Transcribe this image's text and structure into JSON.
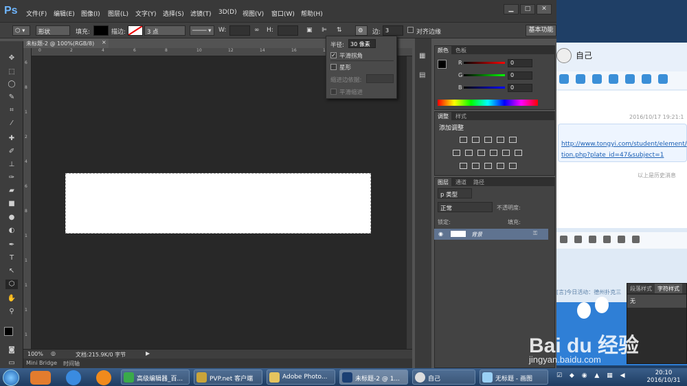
{
  "menu": {
    "items": [
      "文件(F)",
      "编辑(E)",
      "图像(I)",
      "图层(L)",
      "文字(Y)",
      "选择(S)",
      "滤镜(T)",
      "3D(D)",
      "视图(V)",
      "窗口(W)",
      "帮助(H)"
    ],
    "logo": "Ps",
    "min": "▁",
    "max": "□",
    "close": "✕"
  },
  "options": {
    "mode": "形状",
    "fill_label": "填充:",
    "stroke_label": "描边:",
    "stroke_size": "3 点",
    "w_label": "W:",
    "h_label": "H:",
    "sides_label": "边:",
    "sides_value": "3",
    "align_edges": "对齐边缘",
    "workspace": "基本功能"
  },
  "doc": {
    "tab": "未标题-2 @ 100%(RGB/8)",
    "close": "×",
    "zoom": "100%",
    "info": "文档:215.9K/0 字节",
    "ruler_top": [
      "0",
      "2",
      "4",
      "6",
      "8",
      "10",
      "12",
      "14",
      "16",
      "18",
      "20",
      "22"
    ],
    "ruler_left": [
      "6",
      "8",
      "1",
      "2",
      "4",
      "6",
      "8",
      "1",
      "1",
      "1",
      "1",
      "1"
    ],
    "bottom_tabs": [
      "Mini Bridge",
      "时间轴"
    ]
  },
  "popup": {
    "radius_label": "半径:",
    "radius_value": "30 像素",
    "smooth_corners": "平滑拐角",
    "star": "星形",
    "indent_label": "缩进边依据:",
    "smooth_indent": "平滑缩进"
  },
  "color_panel": {
    "tabs": [
      "颜色",
      "色板"
    ],
    "r_label": "R",
    "g_label": "G",
    "b_label": "B",
    "r": "0",
    "g": "0",
    "b": "0"
  },
  "adjust_panel": {
    "tabs": [
      "调整",
      "样式"
    ],
    "title": "添加调整"
  },
  "layers_panel": {
    "tabs": [
      "图层",
      "通道",
      "路径"
    ],
    "kind": "p 类型",
    "blend": "正常",
    "opacity_label": "不透明度:",
    "lock_label": "锁定:",
    "fill_label": "填充:",
    "layer_name": "背景"
  },
  "qq": {
    "name": "自己",
    "time": "2016/10/17 19:21:1",
    "link1": "http://www.tongyi.com/student/element/",
    "link2": "tion.php?plate_id=47&subject=1",
    "history": "以上是历史消息",
    "notice": "[言]今日活动：德州扑克三"
  },
  "char_panel": {
    "tabs": [
      "段落样式",
      "字符样式"
    ],
    "item": "无"
  },
  "taskbar": {
    "tasks": [
      "高级编辑器_百...",
      "PVP.net 客户端",
      "Adobe Photo...",
      "未标题-2 @ 1...",
      "自己",
      "无标题 - 画图"
    ],
    "time": "20:10",
    "date": "2016/10/31"
  },
  "watermark": {
    "main": "Bai du 经验",
    "sub": "jingyan.baidu.com"
  },
  "colors": {
    "accent": "#6fb6ff",
    "selected_layer": "#5f7390"
  }
}
